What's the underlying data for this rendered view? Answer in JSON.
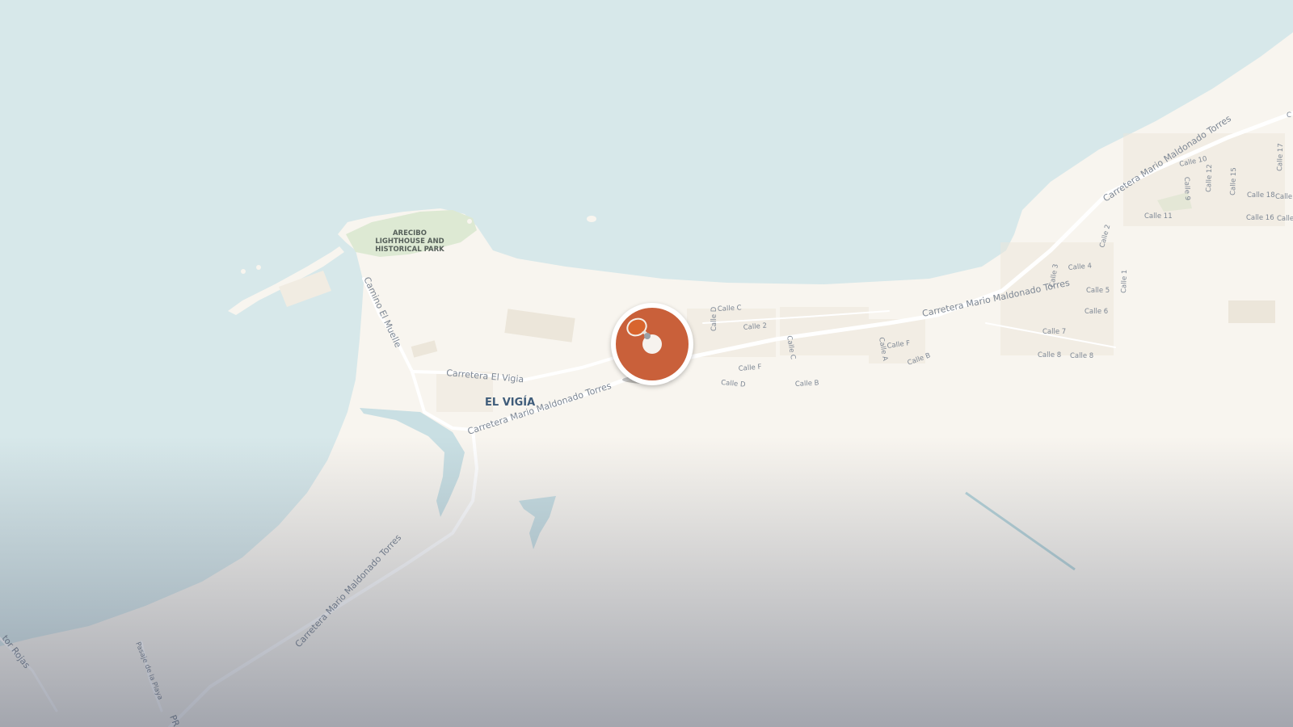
{
  "map": {
    "poi_lines": [
      "ARECIBO",
      "LIGHTHOUSE AND",
      "HISTORICAL PARK"
    ],
    "place_label": "EL VIGÍA",
    "roads": {
      "carretera_el_vigia": "Carretera El Vigia",
      "maldonado_main_west": "Carretera Mario Maldonado Torres",
      "maldonado_main_east": "Carretera Mario Maldonado Torres",
      "maldonado_north_east": "Carretera Mario Maldonado Torres",
      "maldonado_south": "Carretera Mario Maldonado Torres",
      "camino_el_muelle": "Camino El Muelle",
      "pasaje_de_la_playa": "Pasaje de la Playa",
      "tor_rojas": "tor Rojas",
      "pr": "PR"
    },
    "streets": {
      "calle_c_top": "Calle C",
      "calle_d_vertical": "Calle D",
      "calle_2_a": "Calle 2",
      "calle_c_vertical": "Calle C",
      "calle_f_a": "Calle F",
      "calle_d_b": "Calle D",
      "calle_b_a": "Calle B",
      "calle_f_b": "Calle F",
      "calle_a": "Calle A",
      "calle_b_b": "Calle B",
      "calle_10": "Calle 10",
      "calle_9": "Calle 9",
      "calle_12": "Calle 12",
      "calle_15": "Calle 15",
      "calle_17": "Calle 17",
      "calle_18": "Calle 18",
      "calle_trunc": "Calle",
      "calle_11": "Calle 11",
      "calle_16": "Calle 16",
      "calle_trunc2": "Calle",
      "calle_2_b": "Calle 2",
      "calle_4": "Calle 4",
      "calle_3": "Calle 3",
      "calle_1": "Calle 1",
      "calle_5": "Calle 5",
      "calle_6": "Calle 6",
      "calle_7": "Calle 7",
      "calle_8_a": "Calle 8",
      "calle_8_b": "Calle 8",
      "edge_c": "C"
    },
    "colors": {
      "water": "#d7e8ea",
      "land": "#f8f5ef",
      "park": "#dde9d3",
      "marker": "#c9603a"
    },
    "marker_icon": "buoy-icon"
  }
}
